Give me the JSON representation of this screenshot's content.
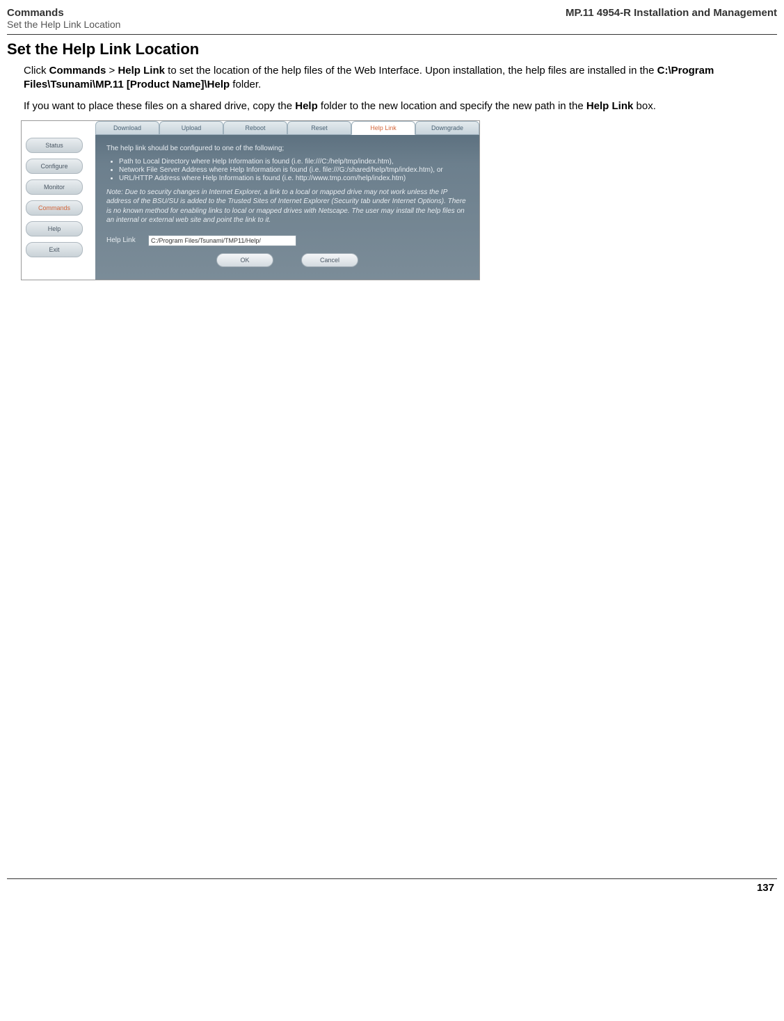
{
  "header": {
    "left_line1": "Commands",
    "left_line2": "Set the Help Link Location",
    "right": "MP.11 4954-R Installation and Management"
  },
  "section_title": "Set the Help Link Location",
  "para1": {
    "t1": "Click ",
    "b1": "Commands",
    "t2": " > ",
    "b2": "Help Link",
    "t3": " to set the location of the help files of the Web Interface. Upon installation, the help files are installed in the ",
    "b3": "C:\\Program Files\\Tsunami\\MP.11 [Product Name]\\Help",
    "t4": " folder."
  },
  "para2": {
    "t1": "If you want to place these files on a shared drive, copy the ",
    "b1": "Help",
    "t2": " folder to the new location and specify the new path in the ",
    "b2": "Help Link",
    "t3": " box."
  },
  "screenshot": {
    "side_buttons": [
      {
        "label": "Status",
        "active": false
      },
      {
        "label": "Configure",
        "active": false
      },
      {
        "label": "Monitor",
        "active": false
      },
      {
        "label": "Commands",
        "active": true
      },
      {
        "label": "Help",
        "active": false
      },
      {
        "label": "Exit",
        "active": false
      }
    ],
    "tabs": [
      {
        "label": "Download",
        "active": false
      },
      {
        "label": "Upload",
        "active": false
      },
      {
        "label": "Reboot",
        "active": false
      },
      {
        "label": "Reset",
        "active": false
      },
      {
        "label": "Help Link",
        "active": true
      },
      {
        "label": "Downgrade",
        "active": false
      }
    ],
    "intro": "The help link should be configured to one of the following;",
    "bullets": [
      "Path to Local Directory where Help Information is found (i.e. file:///C:/help/tmp/index.htm),",
      "Network File Server Address where Help Information is found (i.e. file:///G:/shared/help/tmp/index.htm), or",
      "URL/HTTP Address where Help Information is found (i.e. http://www.tmp.com/help/index.htm)"
    ],
    "note": "Note: Due to security changes in Internet Explorer, a link to a local or mapped drive may not work unless the IP address of the BSU/SU is added to the Trusted Sites of Internet Explorer (Security tab under Internet Options). There is no known method for enabling links to local or mapped drives with Netscape. The user may install the help files on an internal or external web site and point the link to it.",
    "helplink_label": "Help Link",
    "helplink_value": "C:/Program Files/Tsunami/TMP11/Help/",
    "ok_label": "OK",
    "cancel_label": "Cancel"
  },
  "page_number": "137"
}
